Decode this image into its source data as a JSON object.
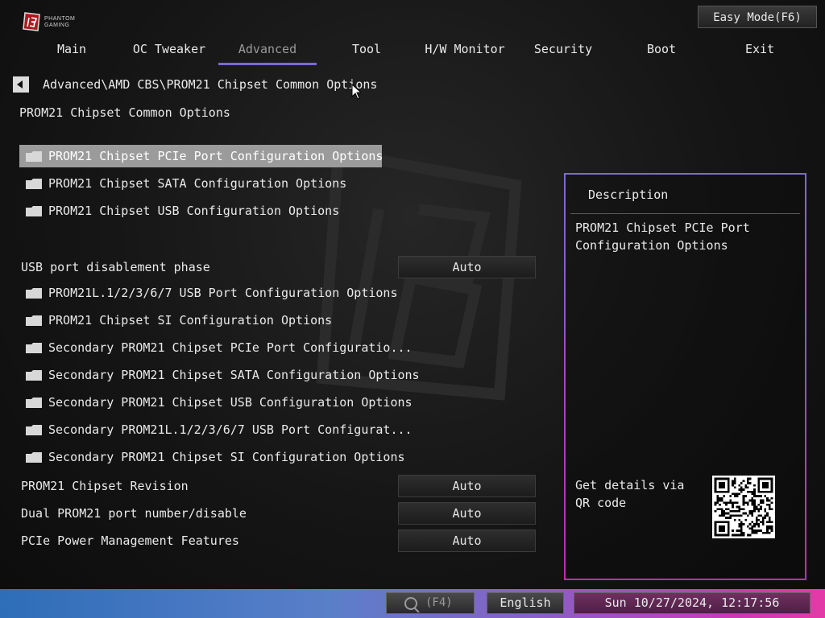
{
  "brand": {
    "line1": "PHANTOM",
    "line2": "GAMING"
  },
  "header": {
    "easy_mode": "Easy Mode(F6)"
  },
  "tabs": [
    {
      "label": "Main"
    },
    {
      "label": "OC Tweaker"
    },
    {
      "label": "Advanced"
    },
    {
      "label": "Tool"
    },
    {
      "label": "H/W Monitor"
    },
    {
      "label": "Security"
    },
    {
      "label": "Boot"
    },
    {
      "label": "Exit"
    }
  ],
  "active_tab": "Advanced",
  "breadcrumb": "Advanced\\AMD CBS\\PROM21 Chipset Common Options",
  "section_title": "PROM21 Chipset Common Options",
  "menu_items": [
    {
      "label": "PROM21 Chipset PCIe Port Configuration Options",
      "selected": true
    },
    {
      "label": "PROM21 Chipset SATA Configuration Options"
    },
    {
      "label": "PROM21 Chipset USB Configuration Options"
    }
  ],
  "usb_setting": {
    "label": "USB port disablement phase",
    "value": "Auto"
  },
  "menu_items_2": [
    {
      "label": "PROM21L.1/2/3/6/7 USB Port Configuration Options"
    },
    {
      "label": "PROM21 Chipset SI Configuration Options"
    },
    {
      "label": "Secondary PROM21 Chipset PCIe Port Configuratio..."
    },
    {
      "label": "Secondary PROM21 Chipset SATA Configuration Options"
    },
    {
      "label": "Secondary PROM21 Chipset USB Configuration Options"
    },
    {
      "label": "Secondary PROM21L.1/2/3/6/7 USB Port Configurat..."
    },
    {
      "label": "Secondary PROM21 Chipset SI Configuration Options"
    }
  ],
  "settings": [
    {
      "label": "PROM21 Chipset Revision",
      "value": "Auto"
    },
    {
      "label": "Dual PROM21 port number/disable",
      "value": "Auto"
    },
    {
      "label": "PCIe Power Management Features",
      "value": "Auto"
    }
  ],
  "description": {
    "title": "Description",
    "text": "PROM21 Chipset PCIe Port Configuration Options",
    "qr_text": "Get details via QR code"
  },
  "statusbar": {
    "search_key": "(F4)",
    "language": "English",
    "datetime": "Sun 10/27/2024, 12:17:56"
  },
  "colors": {
    "accent_purple": "#7a6bd0",
    "accent_pink": "#c32bb0",
    "selected_row": "#9b9b9b"
  },
  "icons": [
    "folder-icon",
    "back-arrow-icon",
    "search-icon",
    "qr-code",
    "brand-logo"
  ]
}
